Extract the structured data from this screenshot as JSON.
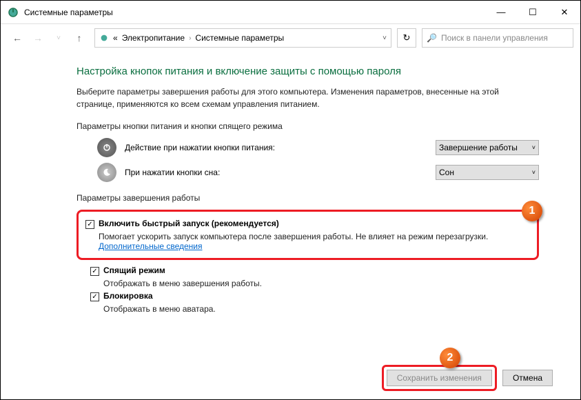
{
  "window": {
    "title": "Системные параметры"
  },
  "breadcrumb": {
    "prefix": "«",
    "item1": "Электропитание",
    "item2": "Системные параметры"
  },
  "search": {
    "placeholder": "Поиск в панели управления"
  },
  "heading": "Настройка кнопок питания и включение защиты с помощью пароля",
  "description": "Выберите параметры завершения работы для этого компьютера. Изменения параметров, внесенные на этой странице, применяются ко всем схемам управления питанием.",
  "section1": {
    "label": "Параметры кнопки питания и кнопки спящего режима",
    "powerBtn": {
      "text": "Действие при нажатии кнопки питания:",
      "value": "Завершение работы"
    },
    "sleepBtn": {
      "text": "При нажатии кнопки сна:",
      "value": "Сон"
    }
  },
  "section2": {
    "label": "Параметры завершения работы",
    "fastStart": {
      "title": "Включить быстрый запуск (рекомендуется)",
      "desc": "Помогает ускорить запуск компьютера после завершения работы. Не влияет на режим перезагрузки. ",
      "link": "Дополнительные сведения"
    },
    "sleep": {
      "title": "Спящий режим",
      "desc": "Отображать в меню завершения работы."
    },
    "lock": {
      "title": "Блокировка",
      "desc": "Отображать в меню аватара."
    }
  },
  "footer": {
    "save": "Сохранить изменения",
    "cancel": "Отмена"
  },
  "badges": {
    "b1": "1",
    "b2": "2"
  }
}
